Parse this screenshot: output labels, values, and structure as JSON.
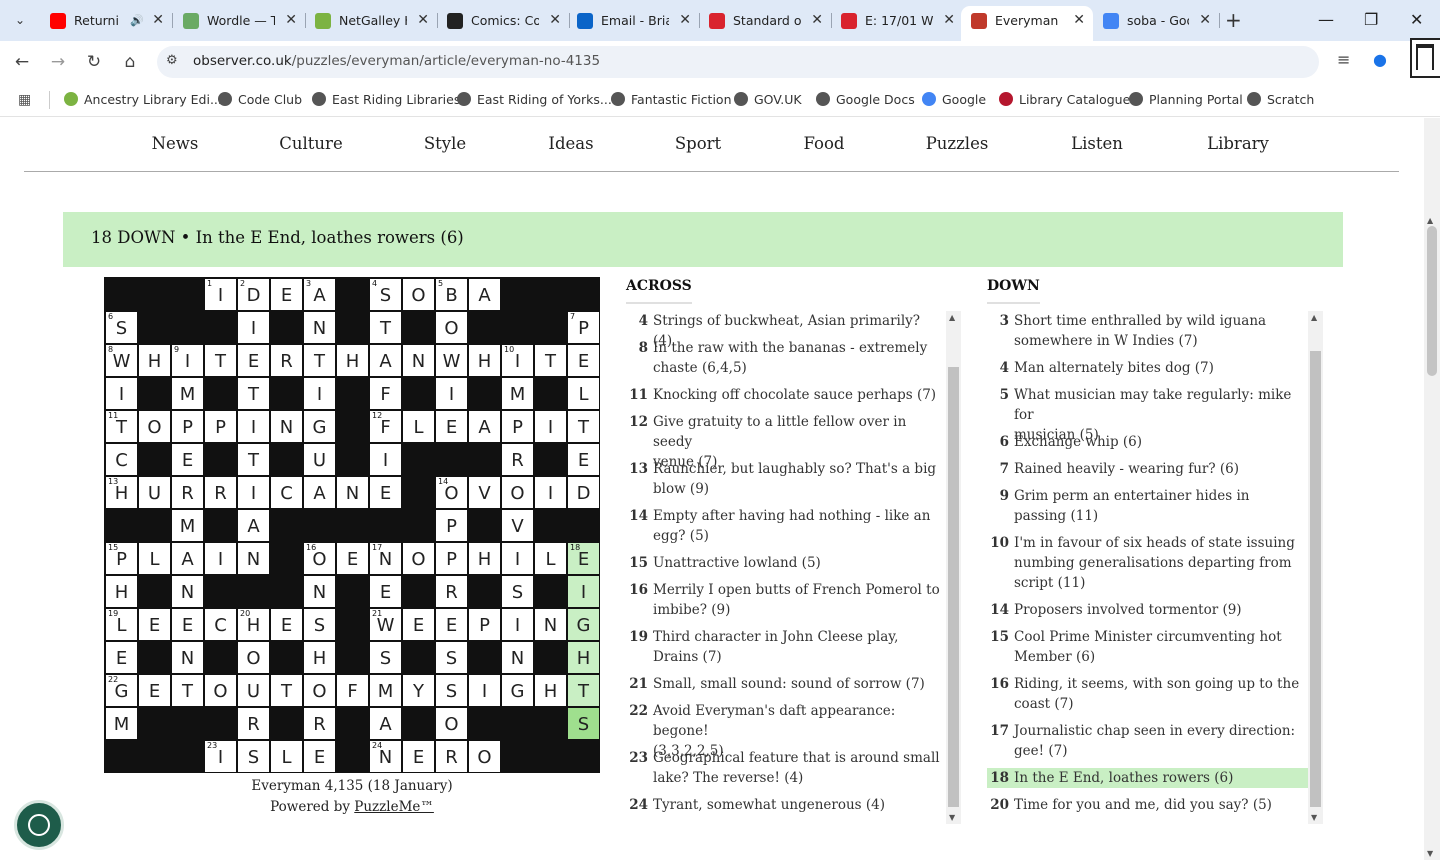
{
  "tabs": [
    {
      "title": "Returni",
      "icon": "youtube-icon",
      "color": "#ff0000",
      "audio": true
    },
    {
      "title": "Wordle — T",
      "icon": "wordle-icon",
      "color": "#6aaa64"
    },
    {
      "title": "NetGalley H",
      "icon": "netgalley-icon",
      "color": "#7cb342"
    },
    {
      "title": "Comics: Co",
      "icon": "comics-icon",
      "color": "#222222"
    },
    {
      "title": "Email - Bria",
      "icon": "outlook-icon",
      "color": "#0a64c8"
    },
    {
      "title": "Standard o",
      "icon": "mse-icon",
      "color": "#d9232e"
    },
    {
      "title": "E: 17/01 W",
      "icon": "mse-icon",
      "color": "#d9232e"
    },
    {
      "title": "Everyman N",
      "icon": "observer-icon",
      "color": "#c0392b"
    },
    {
      "title": "soba - Goo",
      "icon": "google-icon",
      "color": "#4285f4"
    }
  ],
  "url": {
    "domain": "observer.co.uk",
    "path": "/puzzles/everyman/article/everyman-no-4135"
  },
  "bookmarks": [
    "Ancestry Library Edi...",
    "Code Club",
    "East Riding Libraries",
    "East Riding of Yorks...",
    "Fantastic Fiction",
    "GOV.UK",
    "Google Docs",
    "Google",
    "Library Catalogue",
    "Planning Portal",
    "Scratch"
  ],
  "nav": [
    "News",
    "Culture",
    "Style",
    "Ideas",
    "Sport",
    "Food",
    "Puzzles",
    "Listen",
    "Library"
  ],
  "current_clue": "18 DOWN • In the E End, loathes rowers (6)",
  "grid": {
    "rows": [
      "###IDEA#SOBA###",
      "S###I#N#T#O###P",
      "WHITERTHANWHITE",
      "I#M#T#I#F#I#M#L",
      "TOPPING#FLEAPIT",
      "C#E#T#U#I###R#E",
      "HURRICANE#OVOID",
      "##M#A#####P#V##",
      "PLAIN#OENOPHILE",
      "H#N###N#E#R#S#I",
      "LEECHES#WEEPING",
      "E#N#O#H#S#S#N#H",
      "GETOUTOFMYSIGHT",
      "M###R#R#A#O###S",
      "###ISLE#NERO###"
    ],
    "numbers": [
      {
        "r": 0,
        "c": 3,
        "n": "1"
      },
      {
        "r": 0,
        "c": 4,
        "n": "2"
      },
      {
        "r": 0,
        "c": 6,
        "n": "3"
      },
      {
        "r": 0,
        "c": 8,
        "n": "4"
      },
      {
        "r": 0,
        "c": 10,
        "n": "5"
      },
      {
        "r": 1,
        "c": 0,
        "n": "6"
      },
      {
        "r": 1,
        "c": 14,
        "n": "7"
      },
      {
        "r": 2,
        "c": 0,
        "n": "8"
      },
      {
        "r": 2,
        "c": 2,
        "n": "9"
      },
      {
        "r": 2,
        "c": 12,
        "n": "10"
      },
      {
        "r": 4,
        "c": 0,
        "n": "11"
      },
      {
        "r": 4,
        "c": 8,
        "n": "12"
      },
      {
        "r": 6,
        "c": 0,
        "n": "13"
      },
      {
        "r": 6,
        "c": 10,
        "n": "14"
      },
      {
        "r": 8,
        "c": 0,
        "n": "15"
      },
      {
        "r": 8,
        "c": 6,
        "n": "16"
      },
      {
        "r": 8,
        "c": 8,
        "n": "17"
      },
      {
        "r": 8,
        "c": 14,
        "n": "18"
      },
      {
        "r": 10,
        "c": 0,
        "n": "19"
      },
      {
        "r": 10,
        "c": 4,
        "n": "20"
      },
      {
        "r": 10,
        "c": 8,
        "n": "21"
      },
      {
        "r": 12,
        "c": 0,
        "n": "22"
      },
      {
        "r": 14,
        "c": 3,
        "n": "23"
      },
      {
        "r": 14,
        "c": 8,
        "n": "24"
      }
    ],
    "highlight": [
      [
        8,
        14
      ],
      [
        9,
        14
      ],
      [
        10,
        14
      ],
      [
        11,
        14
      ],
      [
        12,
        14
      ]
    ],
    "cursor": [
      13,
      14
    ]
  },
  "caption": {
    "line1": "Everyman 4,135 (18 January)",
    "powered": "Powered by ",
    "brand": "PuzzleMe™"
  },
  "across_title": "ACROSS",
  "down_title": "DOWN",
  "across": [
    {
      "n": "4",
      "lines": [
        "Strings of buckwheat, Asian primarily? (4)"
      ]
    },
    {
      "n": "8",
      "lines": [
        "In the raw with the bananas - extremely",
        "chaste (6,4,5)"
      ]
    },
    {
      "n": "11",
      "lines": [
        "Knocking off chocolate sauce perhaps (7)"
      ]
    },
    {
      "n": "12",
      "lines": [
        "Give gratuity to a little fellow over in seedy",
        "venue (7)"
      ]
    },
    {
      "n": "13",
      "lines": [
        "Raunchier, but laughably so? That's a big",
        "blow (9)"
      ]
    },
    {
      "n": "14",
      "lines": [
        "Empty after having had nothing - like an",
        "egg? (5)"
      ]
    },
    {
      "n": "15",
      "lines": [
        "Unattractive lowland (5)"
      ]
    },
    {
      "n": "16",
      "lines": [
        "Merrily I open butts of French Pomerol to",
        "imbibe? (9)"
      ]
    },
    {
      "n": "19",
      "lines": [
        "Third character in John Cleese play,",
        "Drains (7)"
      ]
    },
    {
      "n": "21",
      "lines": [
        "Small, small sound: sound of sorrow (7)"
      ]
    },
    {
      "n": "22",
      "lines": [
        "Avoid Everyman's daft appearance: begone!",
        " (3,3,2,2,5)"
      ]
    },
    {
      "n": "23",
      "lines": [
        "Geographical feature that is around small",
        "lake? The reverse! (4)"
      ]
    },
    {
      "n": "24",
      "lines": [
        "Tyrant, somewhat ungenerous (4)"
      ]
    }
  ],
  "down": [
    {
      "n": "3",
      "lines": [
        "Short time enthralled by wild iguana",
        "somewhere in W Indies (7)"
      ]
    },
    {
      "n": "4",
      "lines": [
        "Man alternately bites dog (7)"
      ]
    },
    {
      "n": "5",
      "lines": [
        "What musician may take regularly: mike for",
        "musician (5)"
      ]
    },
    {
      "n": "6",
      "lines": [
        "Exchange whip (6)"
      ]
    },
    {
      "n": "7",
      "lines": [
        "Rained heavily - wearing fur? (6)"
      ]
    },
    {
      "n": "9",
      "lines": [
        "Grim perm an entertainer hides in",
        "passing (11)"
      ]
    },
    {
      "n": "10",
      "lines": [
        "I'm in favour of six heads of state issuing",
        "numbing generalisations departing from",
        "script (11)"
      ]
    },
    {
      "n": "14",
      "lines": [
        "Proposers involved tormentor (9)"
      ]
    },
    {
      "n": "15",
      "lines": [
        "Cool Prime Minister circumventing hot",
        "Member (6)"
      ]
    },
    {
      "n": "16",
      "lines": [
        "Riding, it seems, with son going up to the",
        "coast (7)"
      ]
    },
    {
      "n": "17",
      "lines": [
        "Journalistic chap seen in every direction:",
        "gee! (7)"
      ]
    },
    {
      "n": "18",
      "lines": [
        "In the E End, loathes rowers (6)"
      ],
      "active": true
    },
    {
      "n": "20",
      "lines": [
        "Time for you and me, did you say? (5)"
      ]
    }
  ]
}
